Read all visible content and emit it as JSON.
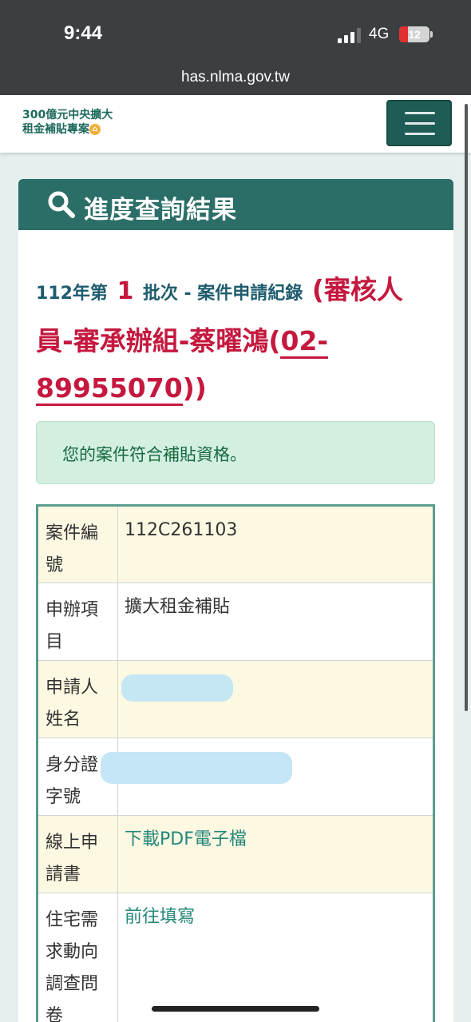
{
  "status": {
    "time": "9:44",
    "network": "4G",
    "battery": "12"
  },
  "browser": {
    "url": "has.nlma.gov.tw"
  },
  "site": {
    "logo_line1": "300億元中央擴大",
    "logo_line2": "租金補貼專案"
  },
  "card": {
    "title": "進度查詢結果",
    "batch_prefix": "112年第",
    "batch_number": "1",
    "batch_suffix": "批次 - 案件申請紀錄",
    "reviewer_part1": "(審核人員-審承辦組-蔡曜鴻(",
    "reviewer_phone": "02-89955070",
    "reviewer_part2": "))"
  },
  "alert": {
    "message": "您的案件符合補貼資格。"
  },
  "table": {
    "rows": [
      {
        "label": "案件編號",
        "value": "112C261103"
      },
      {
        "label": "申辦項目",
        "value": "擴大租金補貼"
      },
      {
        "label": "申請人姓名",
        "value": ""
      },
      {
        "label": "身分證字號",
        "value": ""
      },
      {
        "label": "線上申請書",
        "value": "下載PDF電子檔"
      },
      {
        "label": "住宅需求動向調查問卷",
        "value": "前往填寫"
      }
    ]
  },
  "colors": {
    "header": "#2b6e67",
    "accent_red": "#c5183e",
    "link": "#23877a",
    "alert_bg": "#d3efe0"
  }
}
